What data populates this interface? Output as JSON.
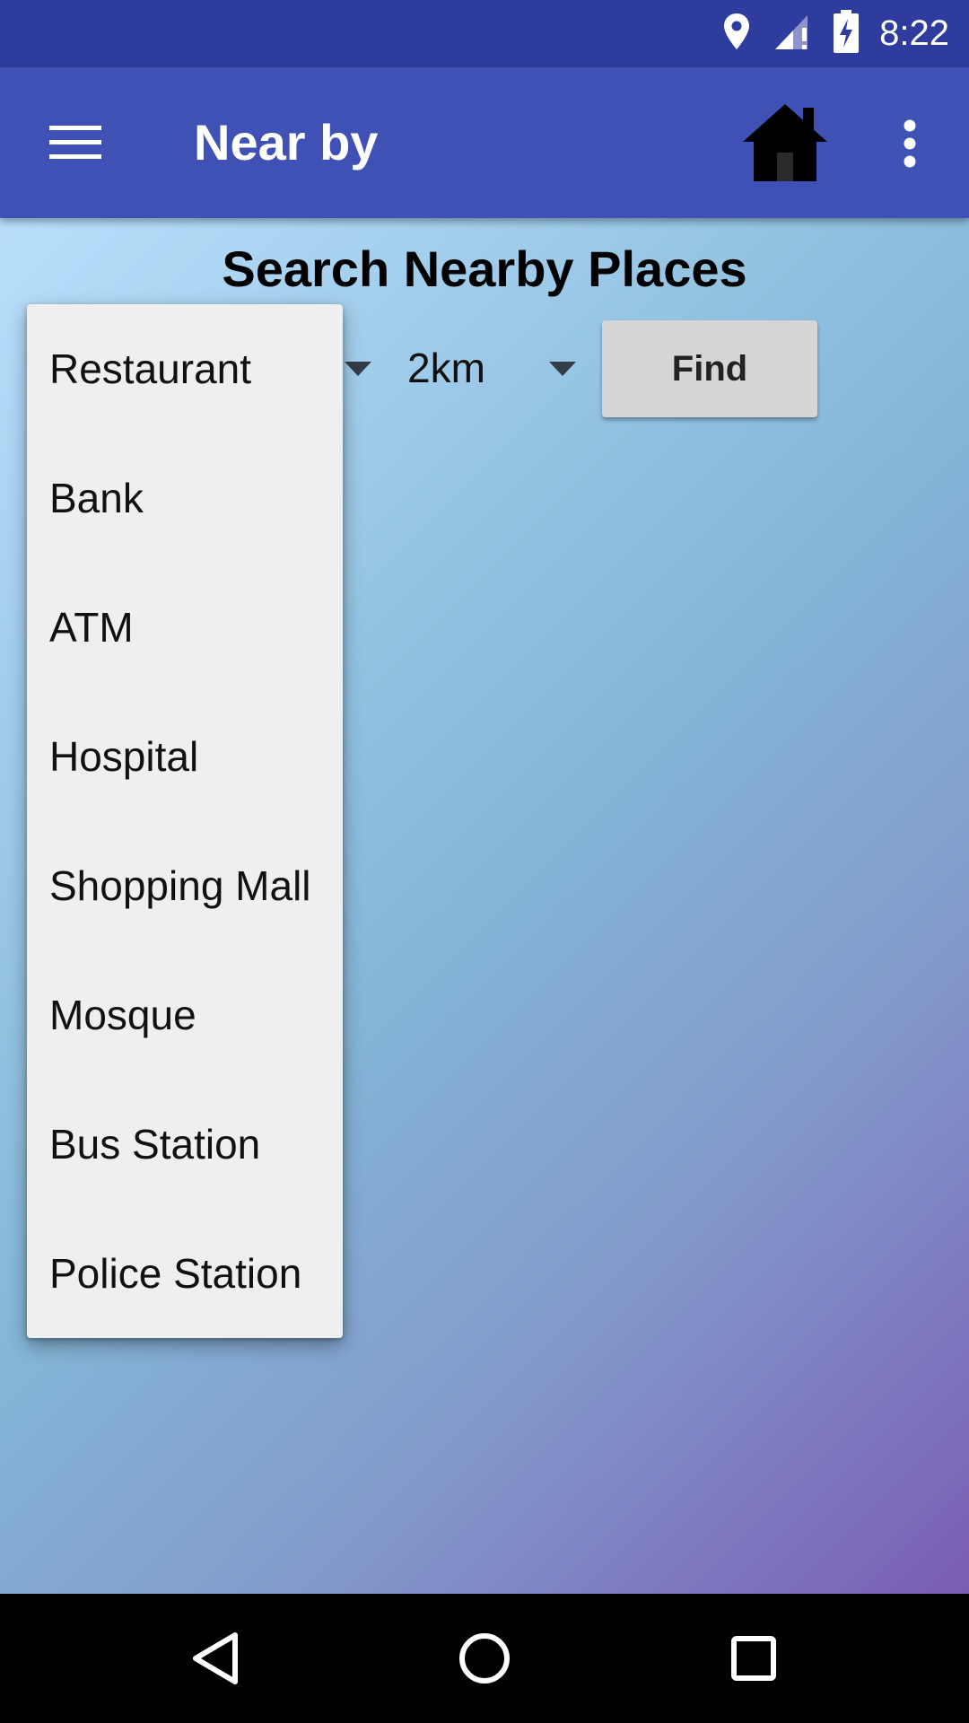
{
  "status_bar": {
    "time": "8:22",
    "icons": [
      "location-icon",
      "signal-icon",
      "battery-charging-icon"
    ]
  },
  "app_bar": {
    "title": "Near by",
    "icons": [
      "menu-icon",
      "home-icon",
      "more-vert-icon"
    ]
  },
  "main": {
    "heading": "Search Nearby Places",
    "distance_spinner": {
      "selected": "2km"
    },
    "find_label": "Find"
  },
  "dropdown": {
    "items": [
      "Restaurant",
      "Bank",
      "ATM",
      "Hospital",
      "Shopping Mall",
      "Mosque",
      "Bus Station",
      "Police Station"
    ]
  },
  "nav_bar": {
    "icons": [
      "back-icon",
      "home-circle-icon",
      "recents-icon"
    ]
  },
  "colors": {
    "status_bar": "#2e3c9e",
    "app_bar": "#3f51b5",
    "dropdown_bg": "#efefef",
    "find_button": "#d6d6d6"
  }
}
